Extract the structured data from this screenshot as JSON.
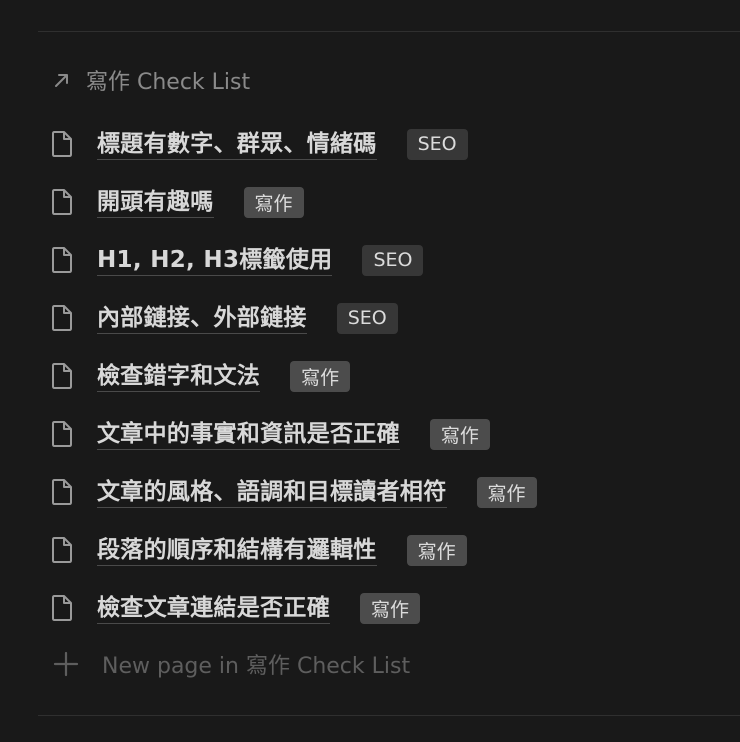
{
  "list": {
    "title": "寫作 Check List",
    "arrow_icon": "arrow-up-right-icon"
  },
  "items": [
    {
      "title": "標題有數字、群眾、情緒碼",
      "tag": "SEO",
      "tag_type": "seo"
    },
    {
      "title": "開頭有趣嗎",
      "tag": "寫作",
      "tag_type": "write"
    },
    {
      "title": "H1, H2, H3標籤使用",
      "tag": "SEO",
      "tag_type": "seo"
    },
    {
      "title": "內部鏈接、外部鏈接",
      "tag": "SEO",
      "tag_type": "seo"
    },
    {
      "title": "檢查錯字和文法",
      "tag": "寫作",
      "tag_type": "write"
    },
    {
      "title": "文章中的事實和資訊是否正確",
      "tag": "寫作",
      "tag_type": "write"
    },
    {
      "title": "文章的風格、語調和目標讀者相符",
      "tag": "寫作",
      "tag_type": "write"
    },
    {
      "title": "段落的順序和結構有邏輯性",
      "tag": "寫作",
      "tag_type": "write"
    },
    {
      "title": "檢查文章連結是否正確",
      "tag": "寫作",
      "tag_type": "write"
    }
  ],
  "new_page": {
    "label": "New page in 寫作 Check List",
    "icon": "plus-icon"
  },
  "colors": {
    "background": "#191919",
    "text": "#d8d8d8",
    "muted": "#8a8a8a",
    "tag_seo": "#373737",
    "tag_write": "#4c4c4c"
  }
}
